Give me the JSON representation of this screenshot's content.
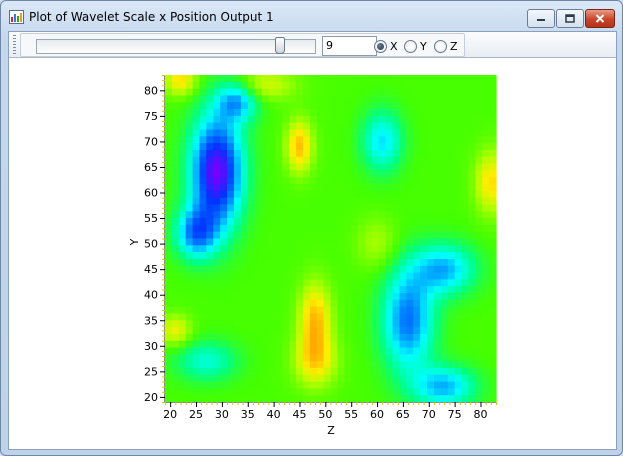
{
  "window": {
    "title": "Plot of Wavelet Scale x Position Output 1",
    "icon": "chart-icon",
    "controls": [
      "minimize-icon",
      "maximize-icon",
      "close-icon"
    ]
  },
  "toolbar": {
    "slice_value": "9",
    "slice_fraction": 0.9,
    "radios": [
      {
        "label": "X",
        "selected": true
      },
      {
        "label": "Y",
        "selected": false
      },
      {
        "label": "Z",
        "selected": false
      }
    ]
  },
  "chart_data": {
    "type": "heatmap",
    "title": "",
    "xlabel": "Z",
    "ylabel": "Y",
    "xlim": [
      19,
      83
    ],
    "ylim": [
      19,
      83
    ],
    "x_ticks": [
      20,
      25,
      30,
      35,
      40,
      45,
      50,
      55,
      60,
      65,
      70,
      75,
      80
    ],
    "y_ticks": [
      20,
      25,
      30,
      35,
      40,
      45,
      50,
      55,
      60,
      65,
      70,
      75,
      80
    ],
    "colormap": [
      "#7700ff",
      "#0033ff",
      "#0088ff",
      "#00ffff",
      "#00ff88",
      "#44ff00",
      "#aaff00",
      "#ffee00",
      "#ffaa00"
    ],
    "value_range": [
      0,
      1
    ],
    "background_value": 0.63,
    "features": [
      {
        "z": 29,
        "y": 64,
        "value": 0.0,
        "spread_z": 5,
        "spread_y": 11
      },
      {
        "z": 25,
        "y": 52,
        "value": 0.25,
        "spread_z": 4,
        "spread_y": 5
      },
      {
        "z": 33,
        "y": 78,
        "value": 0.3,
        "spread_z": 4,
        "spread_y": 4
      },
      {
        "z": 61,
        "y": 70,
        "value": 0.35,
        "spread_z": 4,
        "spread_y": 6
      },
      {
        "z": 66,
        "y": 35,
        "value": 0.22,
        "spread_z": 5,
        "spread_y": 10
      },
      {
        "z": 73,
        "y": 45,
        "value": 0.3,
        "spread_z": 6,
        "spread_y": 5
      },
      {
        "z": 73,
        "y": 22,
        "value": 0.3,
        "spread_z": 6,
        "spread_y": 4
      },
      {
        "z": 27,
        "y": 27,
        "value": 0.42,
        "spread_z": 6,
        "spread_y": 4
      },
      {
        "z": 45,
        "y": 69,
        "value": 0.96,
        "spread_z": 2.5,
        "spread_y": 5
      },
      {
        "z": 48,
        "y": 35,
        "value": 0.97,
        "spread_z": 3,
        "spread_y": 7
      },
      {
        "z": 48,
        "y": 27,
        "value": 0.88,
        "spread_z": 4,
        "spread_y": 5
      },
      {
        "z": 21,
        "y": 33,
        "value": 0.85,
        "spread_z": 3,
        "spread_y": 3
      },
      {
        "z": 38,
        "y": 81,
        "value": 0.82,
        "spread_z": 6,
        "spread_y": 3
      },
      {
        "z": 22,
        "y": 82,
        "value": 0.9,
        "spread_z": 3,
        "spread_y": 3
      },
      {
        "z": 60,
        "y": 50,
        "value": 0.75,
        "spread_z": 4,
        "spread_y": 5
      },
      {
        "z": 82,
        "y": 62,
        "value": 0.9,
        "spread_z": 3,
        "spread_y": 6
      }
    ]
  }
}
